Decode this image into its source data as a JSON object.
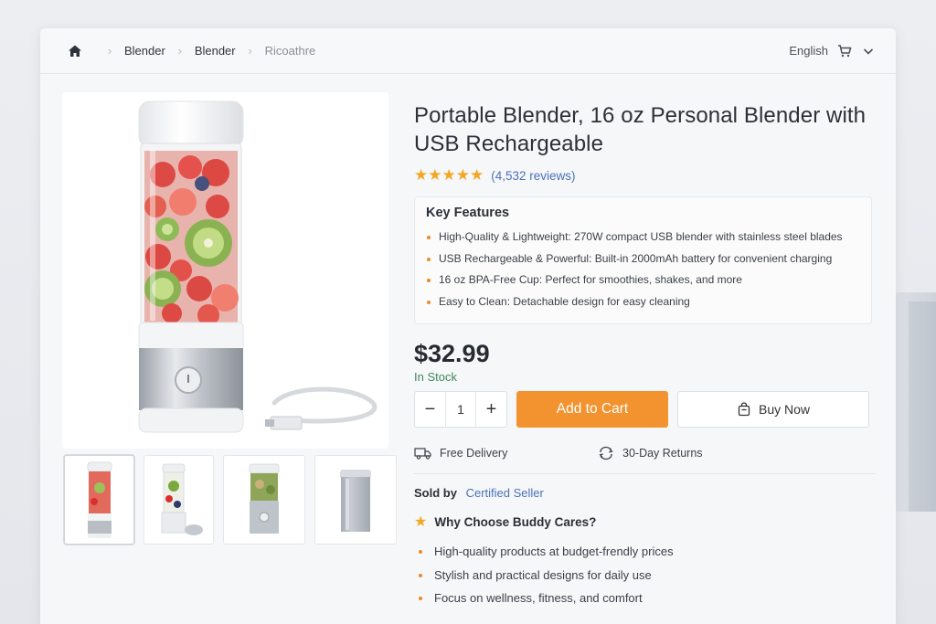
{
  "breadcrumb": {
    "items": [
      "Blender",
      "Blender",
      "Ricoathre"
    ]
  },
  "header": {
    "language": "English"
  },
  "product": {
    "title": "Portable Blender, 16 oz Personal Blender with USB Rechargeable",
    "rating": 5,
    "reviews": "(4,532 reviews)",
    "price": "$32.99",
    "stock": "In Stock"
  },
  "features": {
    "heading": "Key Features",
    "items": [
      "High-Quality & Lightweight: 270W compact USB blender with stainless steel blades",
      "USB Rechargeable & Powerful: Built-in 2000mAh battery for convenient charging",
      "16 oz BPA-Free Cup: Perfect for smoothies, shakes, and more",
      "Easy to Clean: Detachable design for easy cleaning"
    ]
  },
  "purchase": {
    "quantity": "1",
    "minus": "−",
    "plus": "+",
    "add_to_cart": "Add to Cart",
    "buy_now": "Buy Now"
  },
  "perks": {
    "delivery": "Free Delivery",
    "returns": "30-Day Returns"
  },
  "seller": {
    "label": "Sold by",
    "name": "Certified Seller"
  },
  "why": {
    "heading": "Why Choose Buddy Cares?",
    "items": [
      "High-quality products at budget-frendly prices",
      "Stylish and practical designs for daily use",
      "Focus on wellness, fitness, and comfort"
    ]
  },
  "colors": {
    "accent": "#f3932f",
    "link": "#4a72b8",
    "stock": "#3f8a5e",
    "star": "#f5a623"
  },
  "icons": [
    "home-icon",
    "cart-icon",
    "chevron-down-icon",
    "shopping-bag-icon",
    "truck-icon",
    "returns-icon",
    "star-icon"
  ]
}
